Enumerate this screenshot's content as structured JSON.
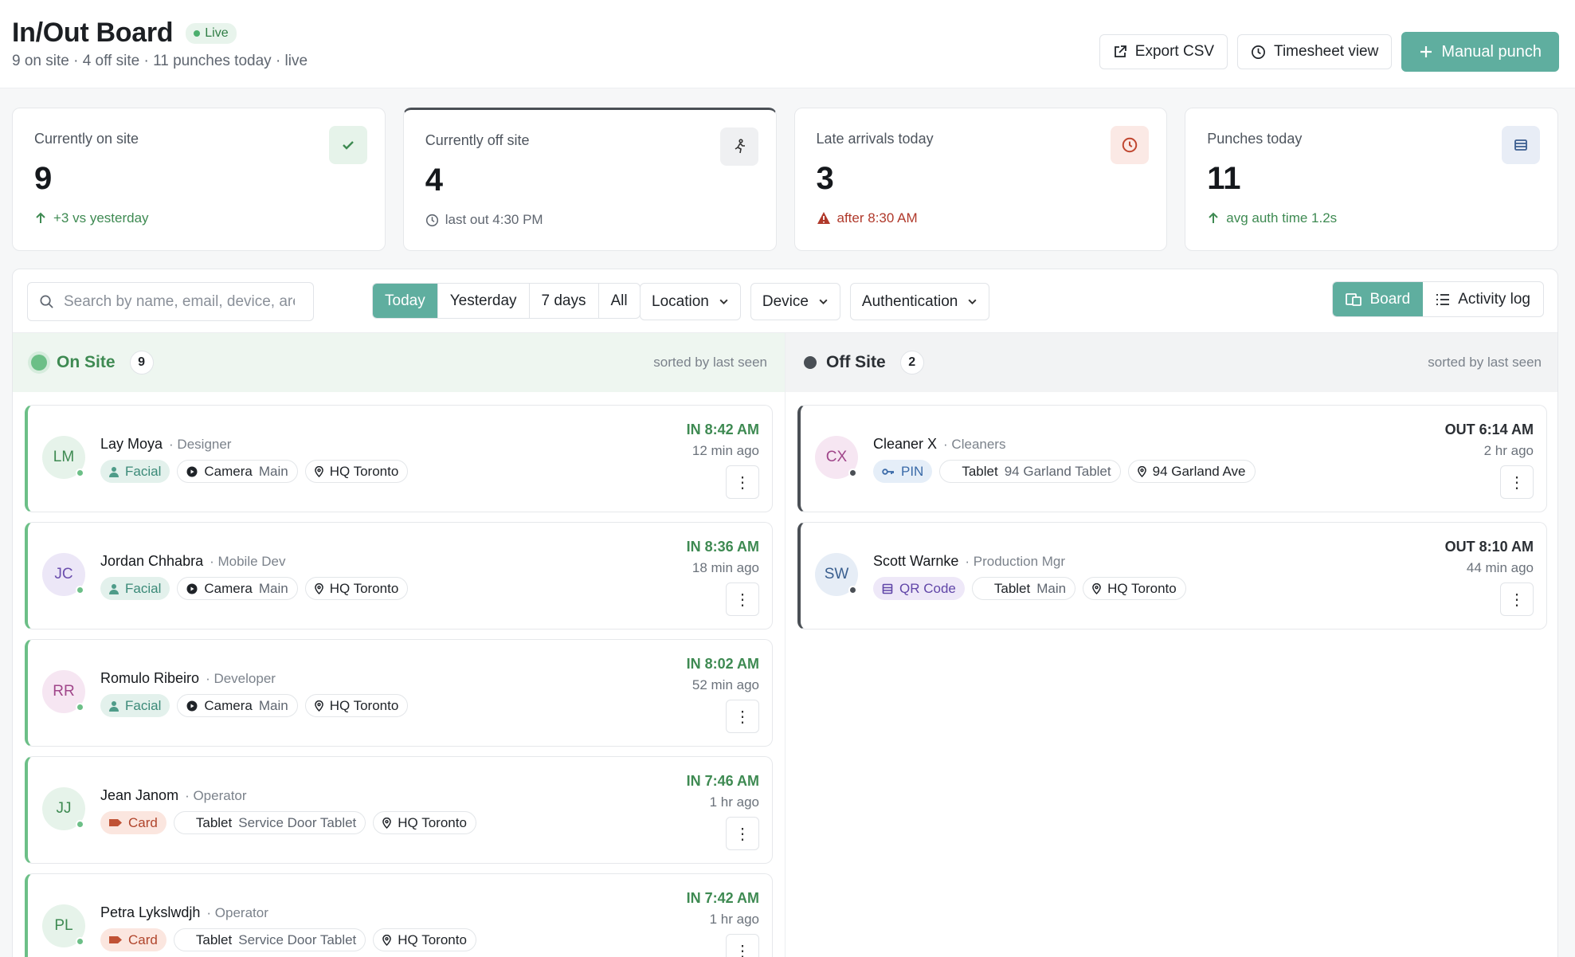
{
  "header": {
    "title": "In/Out Board",
    "live_label": "Live",
    "subtitle": "9 on site · 4 off site · 11 punches today · live",
    "export_label": "Export CSV",
    "timesheet_label": "Timesheet view",
    "manual_punch_label": "Manual punch"
  },
  "stats": [
    {
      "label": "Currently on site",
      "value": "9",
      "note": "+3 vs yesterday",
      "icon": "check-icon"
    },
    {
      "label": "Currently off site",
      "value": "4",
      "note": "last out 4:30 PM",
      "icon": "walking-icon"
    },
    {
      "label": "Late arrivals today",
      "value": "3",
      "note": "after 8:30 AM",
      "icon": "clock-icon"
    },
    {
      "label": "Punches today",
      "value": "11",
      "note": "avg auth time 1.2s",
      "icon": "list-icon"
    }
  ],
  "toolbar": {
    "search_placeholder": "Search by name, email, device, area",
    "ranges": [
      "Today",
      "Yesterday",
      "7 days",
      "All"
    ],
    "location_label": "Location",
    "device_label": "Device",
    "auth_label": "Authentication",
    "board_label": "Board",
    "activity_label": "Activity log"
  },
  "colors": {
    "accent": "#5fae9f",
    "on_site": "#6cbf87",
    "off_site": "#4a4f55",
    "in_time": "#3e8a52",
    "late": "#b0392b"
  },
  "on_site": {
    "title": "On Site",
    "count": "9",
    "sorted": "sorted by last seen",
    "people": [
      {
        "initials": "LM",
        "name": "Lay Moya",
        "role": "· Designer",
        "auth": "Facial",
        "device": "Camera",
        "device_sub": "Main",
        "location": "HQ Toronto",
        "time": "IN 8:42 AM",
        "ago": "12 min ago"
      },
      {
        "initials": "JC",
        "name": "Jordan Chhabra",
        "role": "· Mobile Dev",
        "auth": "Facial",
        "device": "Camera",
        "device_sub": "Main",
        "location": "HQ Toronto",
        "time": "IN 8:36 AM",
        "ago": "18 min ago"
      },
      {
        "initials": "RR",
        "name": "Romulo Ribeiro",
        "role": "· Developer",
        "auth": "Facial",
        "device": "Camera",
        "device_sub": "Main",
        "location": "HQ Toronto",
        "time": "IN 8:02 AM",
        "ago": "52 min ago"
      },
      {
        "initials": "JJ",
        "name": "Jean Janom",
        "role": "· Operator",
        "auth": "Card",
        "device": "Tablet",
        "device_sub": "Service Door Tablet",
        "location": "HQ Toronto",
        "time": "IN 7:46 AM",
        "ago": "1 hr ago"
      },
      {
        "initials": "PL",
        "name": "Petra Lykslwdjh",
        "role": "· Operator",
        "auth": "Card",
        "device": "Tablet",
        "device_sub": "Service Door Tablet",
        "location": "HQ Toronto",
        "time": "IN 7:42 AM",
        "ago": "1 hr ago"
      }
    ]
  },
  "off_site": {
    "title": "Off Site",
    "count": "2",
    "sorted": "sorted by last seen",
    "people": [
      {
        "initials": "CX",
        "name": "Cleaner X",
        "role": "· Cleaners",
        "auth": "PIN",
        "device": "Tablet",
        "device_sub": "94 Garland Tablet",
        "location": "94 Garland Ave",
        "time": "OUT 6:14 AM",
        "ago": "2 hr ago"
      },
      {
        "initials": "SW",
        "name": "Scott Warnke",
        "role": "· Production Mgr",
        "auth": "QR Code",
        "device": "Tablet",
        "device_sub": "Main",
        "location": "HQ Toronto",
        "time": "OUT 8:10 AM",
        "ago": "44 min ago"
      }
    ]
  }
}
